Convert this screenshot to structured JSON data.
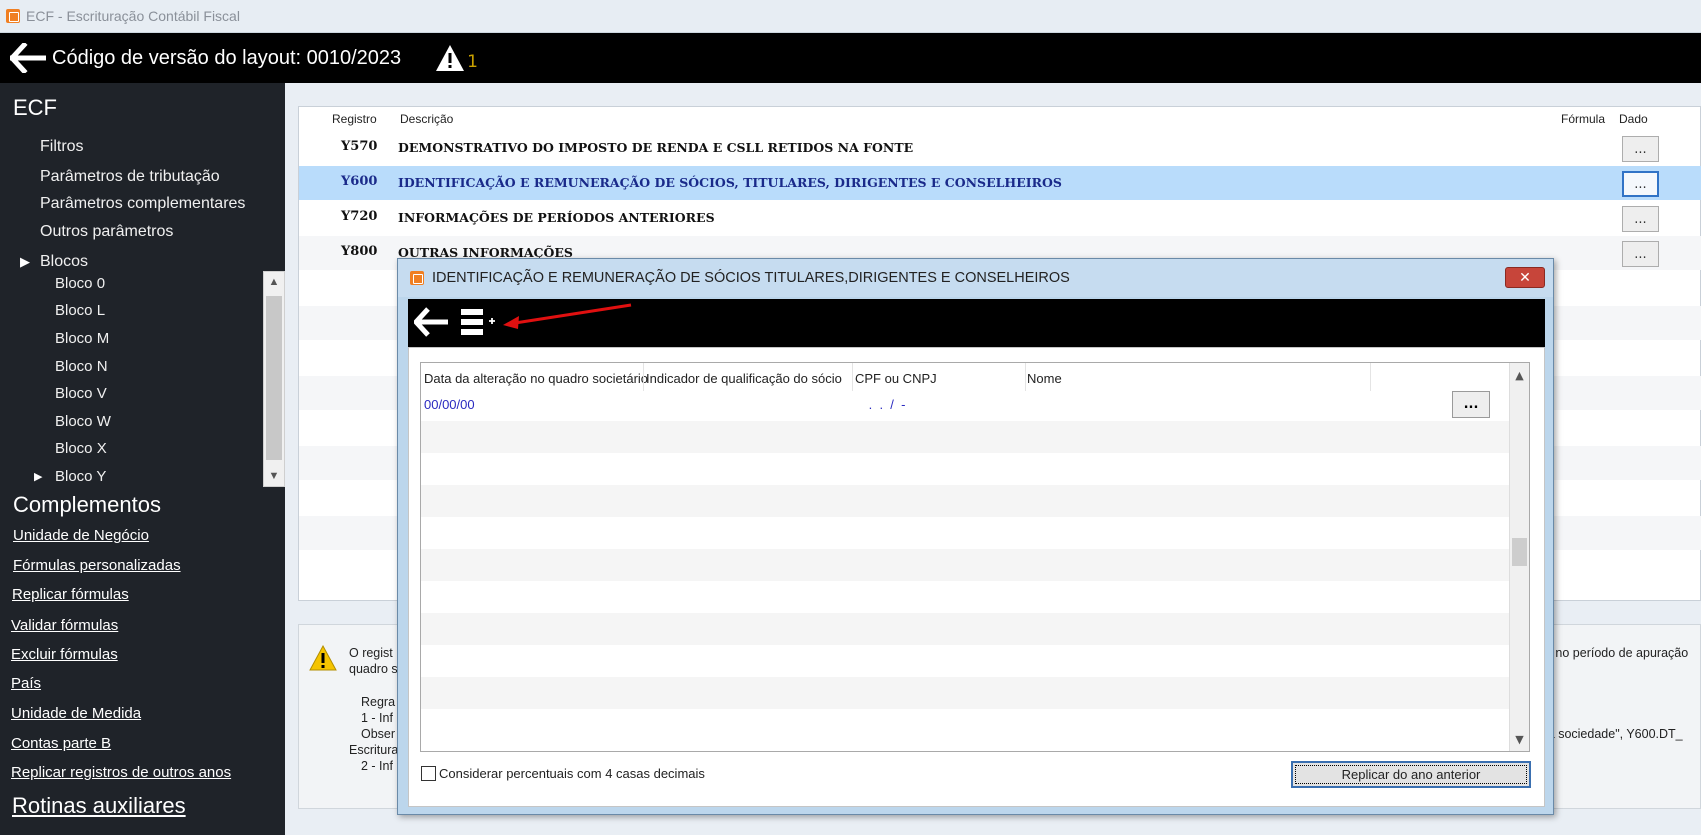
{
  "window": {
    "title": "ECF - Escrituração Contábil Fiscal",
    "icon": "app-icon"
  },
  "header": {
    "text": "Código de versão do layout: 0010/2023",
    "warning_count": "1"
  },
  "sidebar": {
    "ecf_title": "ECF",
    "items": [
      "Filtros",
      "Parâmetros de tributação",
      "Parâmetros complementares",
      "Outros parâmetros"
    ],
    "blocos_label": "Blocos",
    "blocos": [
      "Bloco 0",
      "Bloco L",
      "Bloco M",
      "Bloco N",
      "Bloco V",
      "Bloco W",
      "Bloco X",
      "Bloco Y"
    ],
    "complementos_title": "Complementos",
    "complementos": [
      "Unidade de Negócio",
      "Fórmulas personalizadas",
      "Replicar fórmulas",
      "Validar fórmulas",
      "Excluir fórmulas",
      "País",
      "Unidade de Medida",
      "Contas parte B",
      "Replicar registros de outros anos"
    ],
    "rotinas_title": "Rotinas auxiliares"
  },
  "main_table": {
    "columns": [
      "Registro",
      "Descrição",
      "Fórmula",
      "Dado"
    ],
    "rows": [
      {
        "code": "Y570",
        "desc": "DEMONSTRATIVO DO IMPOSTO DE RENDA E CSLL RETIDOS NA FONTE",
        "btn": "..."
      },
      {
        "code": "Y600",
        "desc": "IDENTIFICAÇÃO E REMUNERAÇÃO DE SÓCIOS, TITULARES, DIRIGENTES E CONSELHEIROS",
        "btn": "..."
      },
      {
        "code": "Y720",
        "desc": "INFORMAÇÕES DE PERÍODOS ANTERIORES",
        "btn": "..."
      },
      {
        "code": "Y800",
        "desc": "OUTRAS INFORMAÇÕES",
        "btn": "..."
      }
    ],
    "selected_row": 1
  },
  "info_panel": {
    "line1_left": "O regist",
    "line1_right": "e no período de apuração",
    "line2_left": "quadro s",
    "line3": "Regra",
    "line4": "1 - Inf",
    "line5_left": "Obser",
    "line5_right": "ia sociedade\", Y600.DT_",
    "line6": "Escritura",
    "line7": "2 - Inf"
  },
  "dialog": {
    "title": "IDENTIFICAÇÃO E REMUNERAÇÃO DE SÓCIOS TITULARES,DIRIGENTES E CONSELHEIROS",
    "close_label": "✕",
    "grid": {
      "columns": [
        "Data da alteração no quadro societário",
        "Indicador de qualificação do sócio",
        "CPF ou CNPJ",
        "Nome"
      ],
      "first_row": {
        "date": "00/00/00",
        "cpf": " .  .  /  - "
      },
      "row_button": "..."
    },
    "checkbox_label": "Considerar percentuais com 4 casas decimais",
    "replicar_button": "Replicar do ano anterior",
    "accent": "#e01010"
  }
}
